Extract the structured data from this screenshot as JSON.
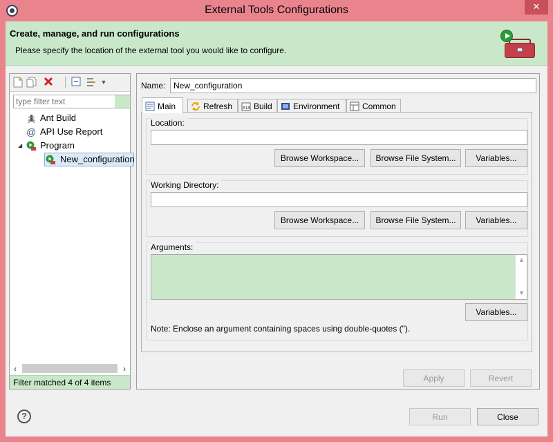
{
  "window": {
    "title": "External Tools Configurations",
    "close_glyph": "✕"
  },
  "banner": {
    "title": "Create, manage, and run configurations",
    "subtitle": "Please specify the location of the external tool you would like to configure.",
    "icon": "toolbox-run-icon"
  },
  "left": {
    "toolbar": {
      "icons": [
        "new-config-icon",
        "duplicate-icon",
        "delete-icon",
        "collapse-all-icon",
        "filter-icon",
        "dropdown-arrow-icon"
      ]
    },
    "filter_placeholder": "type filter text",
    "tree": [
      {
        "label": "Ant Build",
        "icon": "ant-icon",
        "depth": 1
      },
      {
        "label": "API Use Report",
        "icon": "api-report-icon",
        "depth": 1
      },
      {
        "label": "Program",
        "icon": "program-icon",
        "depth": 1,
        "expanded": true
      },
      {
        "label": "New_configuration",
        "icon": "program-config-icon",
        "depth": 2,
        "selected": true
      }
    ],
    "status": "Filter matched 4 of 4 items"
  },
  "right": {
    "name_label": "Name:",
    "name_value": "New_configuration",
    "tabs": [
      {
        "label": "Main",
        "icon": "main-tab-icon",
        "active": true
      },
      {
        "label": "Refresh",
        "icon": "refresh-icon"
      },
      {
        "label": "Build",
        "icon": "build-icon"
      },
      {
        "label": "Environment",
        "icon": "environment-icon"
      },
      {
        "label": "Common",
        "icon": "common-icon"
      }
    ],
    "location": {
      "label": "Location:",
      "value": "",
      "buttons": [
        "Browse Workspace...",
        "Browse File System...",
        "Variables..."
      ]
    },
    "working_dir": {
      "label": "Working Directory:",
      "value": "",
      "buttons": [
        "Browse Workspace...",
        "Browse File System...",
        "Variables..."
      ]
    },
    "arguments": {
      "label": "Arguments:",
      "value": "",
      "button": "Variables...",
      "note": "Note: Enclose an argument containing spaces using double-quotes (\")."
    },
    "apply": "Apply",
    "revert": "Revert"
  },
  "footer": {
    "help": "?",
    "run": "Run",
    "close": "Close"
  },
  "colors": {
    "title_bar": "#e9848d",
    "banner": "#c9e8c9",
    "close_button": "#c7505a"
  }
}
